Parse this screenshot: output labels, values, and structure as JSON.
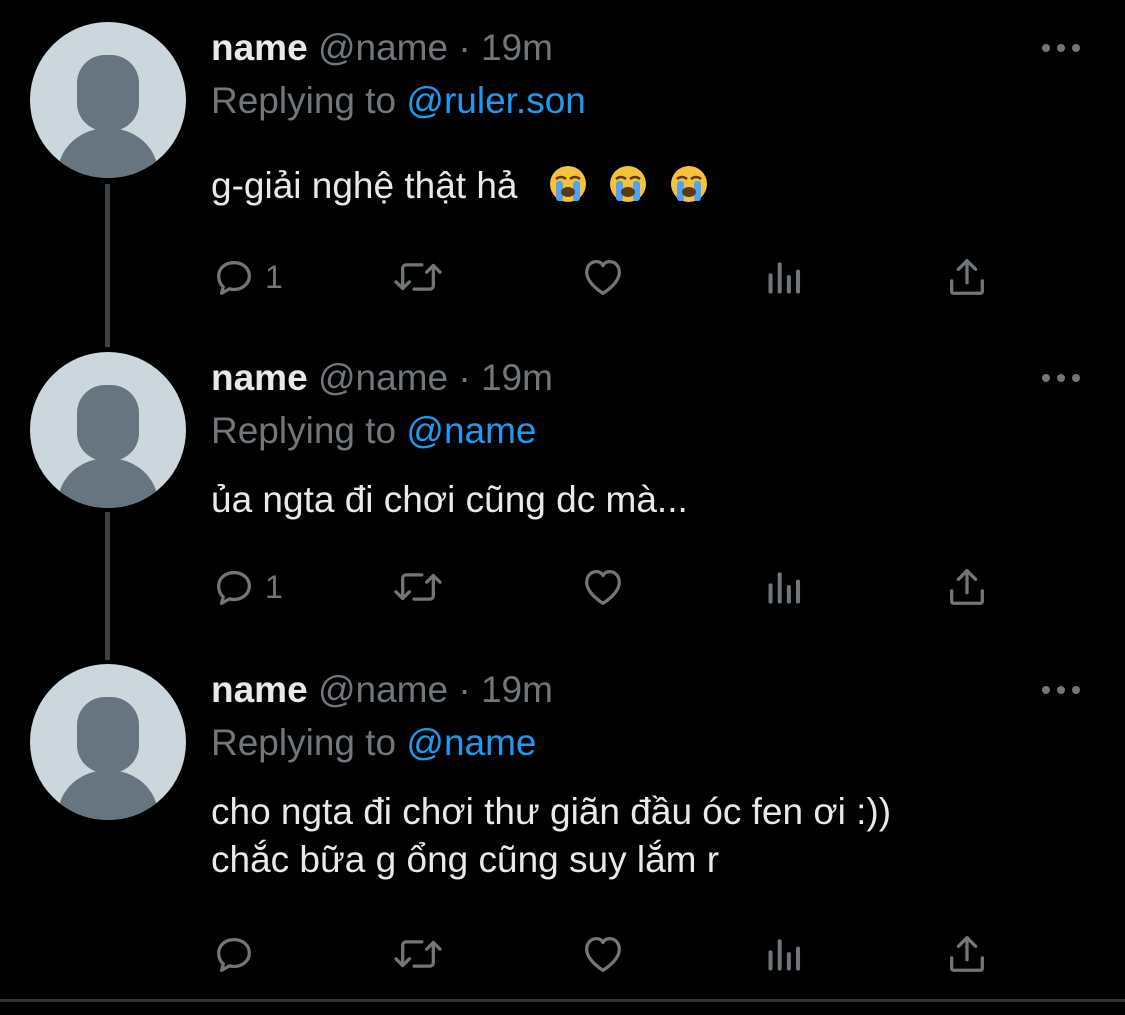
{
  "tweets": [
    {
      "name": "name",
      "handle": "@name",
      "separator": "·",
      "time": "19m",
      "replying_prefix": "Replying to ",
      "replying_to": "@ruler.son",
      "text": "g-giải nghệ thật hả",
      "emojis": [
        "loudly-crying-face",
        "loudly-crying-face",
        "loudly-crying-face"
      ],
      "reply_count": "1"
    },
    {
      "name": "name",
      "handle": "@name",
      "separator": "·",
      "time": "19m",
      "replying_prefix": "Replying to ",
      "replying_to": "@name",
      "text": "ủa ngta đi chơi cũng dc mà...",
      "reply_count": "1"
    },
    {
      "name": "name",
      "handle": "@name",
      "separator": "·",
      "time": "19m",
      "replying_prefix": "Replying to ",
      "replying_to": "@name",
      "text_line1": "cho ngta đi chơi thư giãn đầu óc fen ơi :))",
      "text_line2": "chắc bữa g ổng cũng suy lắm r",
      "reply_count": ""
    }
  ],
  "icons": {
    "reply": "reply-icon",
    "retweet": "retweet-icon",
    "like": "heart-icon",
    "analytics": "analytics-icon",
    "share": "share-icon",
    "more": "more-icon"
  },
  "colors": {
    "background": "#000000",
    "text": "#e7e9ea",
    "secondary": "#71767b",
    "accent": "#1d9bf0",
    "avatar_bg": "#ccd6dd",
    "avatar_fg": "#66757f"
  }
}
